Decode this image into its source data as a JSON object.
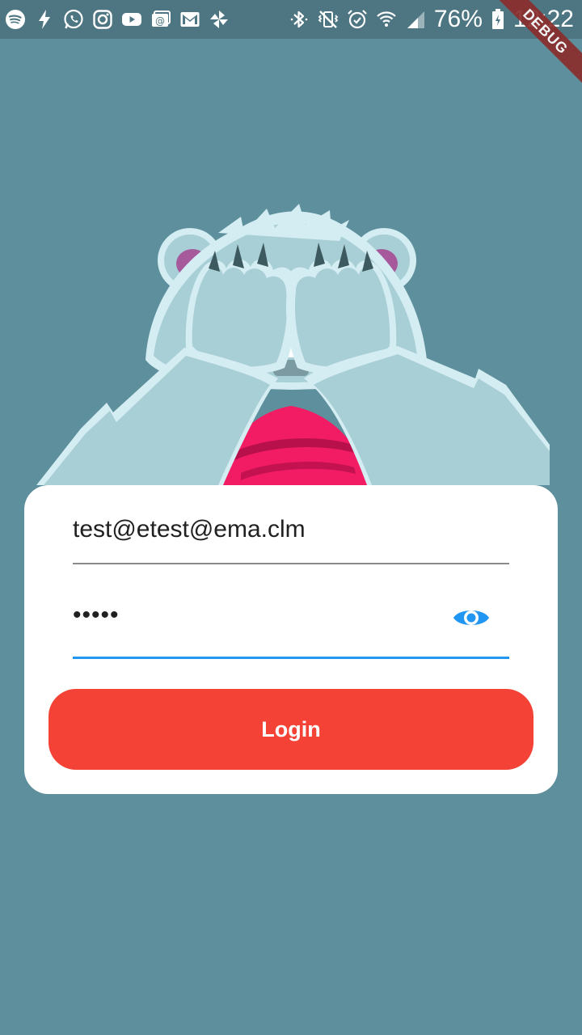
{
  "status_bar": {
    "left_icons": [
      "spotify-icon",
      "bolt-icon",
      "whatsapp-icon",
      "instagram-icon",
      "youtube-icon",
      "email-at-icon",
      "gmail-icon",
      "pinwheel-icon"
    ],
    "right_icons": [
      "bluetooth-icon",
      "vibrate-icon",
      "alarm-icon",
      "wifi-icon",
      "cell-signal-icon",
      "battery-icon"
    ],
    "battery_percent": "76%",
    "time": "12:22"
  },
  "debug_banner": {
    "label": "DEBUG"
  },
  "illustration": {
    "name": "bear-covering-eyes"
  },
  "login_form": {
    "email_value": "test@etest@ema.clm",
    "password_value": "•••••",
    "password_visibility_icon": "eye-icon",
    "login_label": "Login"
  },
  "colors": {
    "background": "#5e8f9c",
    "status_bar": "#4e7682",
    "card": "#ffffff",
    "login_button": "#f44336",
    "focus_underline": "#2196f3",
    "eye_icon": "#2196f3",
    "bear_fur": "#a9cfd6",
    "bear_scarf": "#f21c64"
  }
}
